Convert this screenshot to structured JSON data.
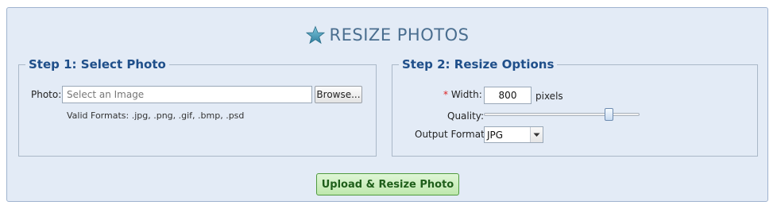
{
  "page_title": "RESIZE PHOTOS",
  "step1": {
    "legend": "Step 1: Select Photo",
    "photo_label": "Photo:",
    "photo_placeholder": "Select an Image",
    "browse_label": "Browse...",
    "valid_formats": "Valid Formats: .jpg, .png, .gif, .bmp, .psd"
  },
  "step2": {
    "legend": "Step 2: Resize Options",
    "required_marker": "*",
    "width_label": "Width:",
    "width_value": "800",
    "width_unit": "pixels",
    "quality_label": "Quality:",
    "quality_level_fraction": 0.82,
    "output_format_label": "Output Format:",
    "output_format_value": "JPG"
  },
  "submit_label": "Upload & Resize Photo",
  "icons": {
    "title_icon": "star-icon",
    "select_arrow": "chevron-down-icon"
  },
  "colors": {
    "panel_bg": "#e3ebf6",
    "legend_text": "#1f4f8a",
    "title_text": "#4a6e8f",
    "upload_bg": "#bfe8ad",
    "required": "#d22222"
  }
}
